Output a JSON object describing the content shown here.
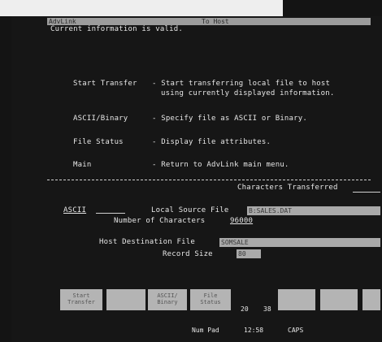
{
  "title_bar": {
    "left": "AdvLink",
    "right": "To Host"
  },
  "status_message": "Current information is valid.",
  "menu_items": [
    {
      "key": "Start Transfer",
      "desc1": "- Start transferring local file to host",
      "desc2": "using currently displayed information."
    },
    {
      "key": "ASCII/Binary",
      "desc1": "- Specify file as ASCII or Binary.",
      "desc2": ""
    },
    {
      "key": "File Status",
      "desc1": "- Display file attributes.",
      "desc2": ""
    },
    {
      "key": "Main",
      "desc1": "- Return to AdvLink main menu.",
      "desc2": ""
    }
  ],
  "characters_transferred_label": "Characters Transferred",
  "transfer": {
    "mode": "ASCII",
    "local_source_label": "Local Source File",
    "local_source_value": "B:SALES.DAT",
    "num_chars_label": "Number of Characters",
    "num_chars_value": "96000",
    "host_dest_label": "Host Destination File",
    "host_dest_value": "SOMSALE",
    "record_size_label": "Record Size",
    "record_size_value": "80"
  },
  "function_keys": [
    {
      "line1": "Start",
      "line2": "Transfer"
    },
    {
      "line1": "",
      "line2": ""
    },
    {
      "line1": "ASCII/",
      "line2": "Binary"
    },
    {
      "line1": "File",
      "line2": "Status"
    },
    {
      "line1": "",
      "line2": ""
    },
    {
      "line1": "",
      "line2": ""
    },
    {
      "line1": "",
      "line2": ""
    }
  ],
  "status_bar": {
    "row": "20",
    "col": "38",
    "num_pad": "Num Pad",
    "time": "12:58",
    "caps": "CAPS"
  },
  "colors": {
    "screen": "#161616",
    "text": "#e6e6e6",
    "field": "#a9a9a9",
    "fkey": "#b4b4b4"
  }
}
